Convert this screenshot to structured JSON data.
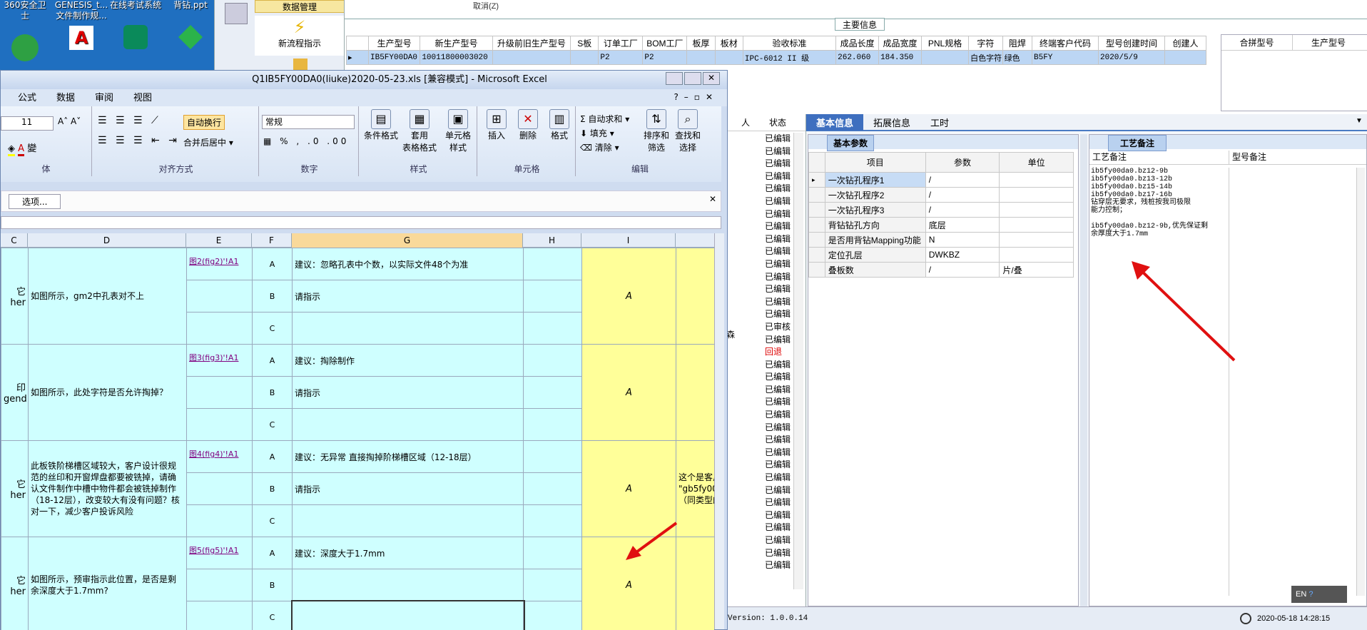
{
  "desktop": {
    "icons": [
      "360安全卫士",
      "GENESIS_t...\n文件制作规...",
      "在线考试系统",
      "背钻.ppt"
    ]
  },
  "mis": {
    "nav": {
      "top_item": "数据管理",
      "flow_item": "新流程指示"
    },
    "cancel_label": "取消(Z)",
    "main_info_title": "主要信息",
    "order_headers": [
      "生产型号",
      "新生产型号",
      "升级前旧生产型号",
      "S板",
      "订单工厂",
      "BOM工厂",
      "板厚",
      "板材",
      "验收标准",
      "成品长度",
      "成品宽度",
      "PNL规格",
      "字符",
      "阻焊",
      "终端客户代码",
      "型号创建时间",
      "创建人"
    ],
    "order_row": [
      "IB5FY00DA0",
      "10011800003020",
      "",
      "",
      "P2",
      "P2",
      "",
      "",
      "IPC-6012 II 级",
      "262.060",
      "184.350",
      "",
      "白色字符",
      "绿色",
      "B5FY",
      "2020/5/9",
      ""
    ],
    "merge_headers": [
      "合拼型号",
      "生产型号"
    ],
    "status_header": "状态",
    "status_person_header": "人",
    "status_values": [
      "已编辑",
      "已编辑",
      "已编辑",
      "已编辑",
      "已编辑",
      "已编辑",
      "已编辑",
      "已编辑",
      "已编辑",
      "已编辑",
      "已编辑",
      "已编辑",
      "已编辑",
      "已编辑",
      "已编辑",
      "已审核",
      "已编辑",
      "回退",
      "已编辑",
      "已编辑",
      "已编辑",
      "已编辑",
      "已编辑",
      "已编辑",
      "已编辑",
      "已编辑",
      "已编辑",
      "已编辑",
      "已编辑",
      "已编辑",
      "已编辑",
      "已编辑",
      "已编辑",
      "已编辑",
      "已编辑"
    ],
    "status_side_char": "森",
    "tabs": [
      "基本信息",
      "拓展信息",
      "工时"
    ],
    "basic_params_title": "基本参数",
    "param_headers": [
      "项目",
      "参数",
      "单位"
    ],
    "params": [
      {
        "item": "一次钻孔程序1",
        "value": "/",
        "unit": ""
      },
      {
        "item": "一次钻孔程序2",
        "value": "/",
        "unit": ""
      },
      {
        "item": "一次钻孔程序3",
        "value": "/",
        "unit": ""
      },
      {
        "item": "背钻钻孔方向",
        "value": "底层",
        "unit": ""
      },
      {
        "item": "是否用背钻Mapping功能",
        "value": "N",
        "unit": ""
      },
      {
        "item": "定位孔层",
        "value": "DWKBZ",
        "unit": ""
      },
      {
        "item": "叠板数",
        "value": "/",
        "unit": "片/叠"
      }
    ],
    "process_notes_title": "工艺备注",
    "process_notes_header": "工艺备注",
    "model_notes_header": "型号备注",
    "process_notes_text": "ib5fy00da0.bz12-9b\nib5fy00da0.bz13-12b\nib5fy00da0.bz15-14b\nib5fy00da0.bz17-16b\n钻穿层无要求，残桩按我司极限\n能力控制；\n\nib5fy00da0.bz12-9b,优先保证剩\n余厚度大于1.7mm",
    "version": "Version: 1.0.0.14",
    "datetime": "2020-05-18 14:28:15",
    "ime": "EN"
  },
  "excel": {
    "title": "Q1IB5FY00DA0(liuke)2020-05-23.xls  [兼容模式] - Microsoft Excel",
    "menu_tabs": [
      "公式",
      "数据",
      "审阅",
      "视图"
    ],
    "font_size": "11",
    "number_format": "常规",
    "wrap_text": "自动换行",
    "merge_center": "合并后居中",
    "cond_format": "条件格式",
    "table_format": "套用\n表格格式",
    "cell_style": "单元格\n样式",
    "insert": "插入",
    "delete": "删除",
    "format": "格式",
    "autosum": "自动求和",
    "fill": "填充",
    "clear": "清除",
    "sort_filter": "排序和\n筛选",
    "find_select": "查找和\n选择",
    "groups": [
      "体",
      "对齐方式",
      "数字",
      "样式",
      "单元格",
      "编辑"
    ],
    "options_btn": "选项...",
    "col_headers": [
      "C",
      "D",
      "E",
      "F",
      "G",
      "H",
      "I"
    ],
    "rows": [
      {
        "c": "它\nher",
        "d": "如图所示，gm2中孔表对不上",
        "link": "图2(fig2)'!A1",
        "opts": [
          "建议：忽略孔表中个数，以实际文件48个为准",
          "请指示",
          ""
        ],
        "i": "A",
        "j": ""
      },
      {
        "c": "印\ngend",
        "d": "如图所示，此处字符是否允许掏掉？",
        "link": "图3(fig3)'!A1",
        "opts": [
          "建议：掏除制作",
          "请指示",
          ""
        ],
        "i": "A",
        "j": ""
      },
      {
        "c": "它\nher",
        "d": "此板铁阶梯槽区域较大，客户设计很规范的丝印和开窗焊盘都要被铣掉，请确认文件制作中槽中物件都会被铣掉制作（18-12层），改变较大有没有问题？核对一下，减少客户投诉风险",
        "link": "图4(fig4)'!A1",
        "opts": [
          "建议：无异常 直接掏掉阶梯槽区域（12-18层）",
          "请指示",
          ""
        ],
        "i": "A",
        "j": "这个是客户\n\"gb5fy00\n（同类型的"
      },
      {
        "c": "它\nher",
        "d": "如图所示，预审指示此位置，是否是剩余深度大于1.7mm?",
        "link": "图5(fig5)'!A1",
        "opts": [
          "建议：深度大于1.7mm",
          "",
          ""
        ],
        "i": "A",
        "j": ""
      }
    ],
    "row_letters": [
      "A",
      "B",
      "C"
    ]
  }
}
